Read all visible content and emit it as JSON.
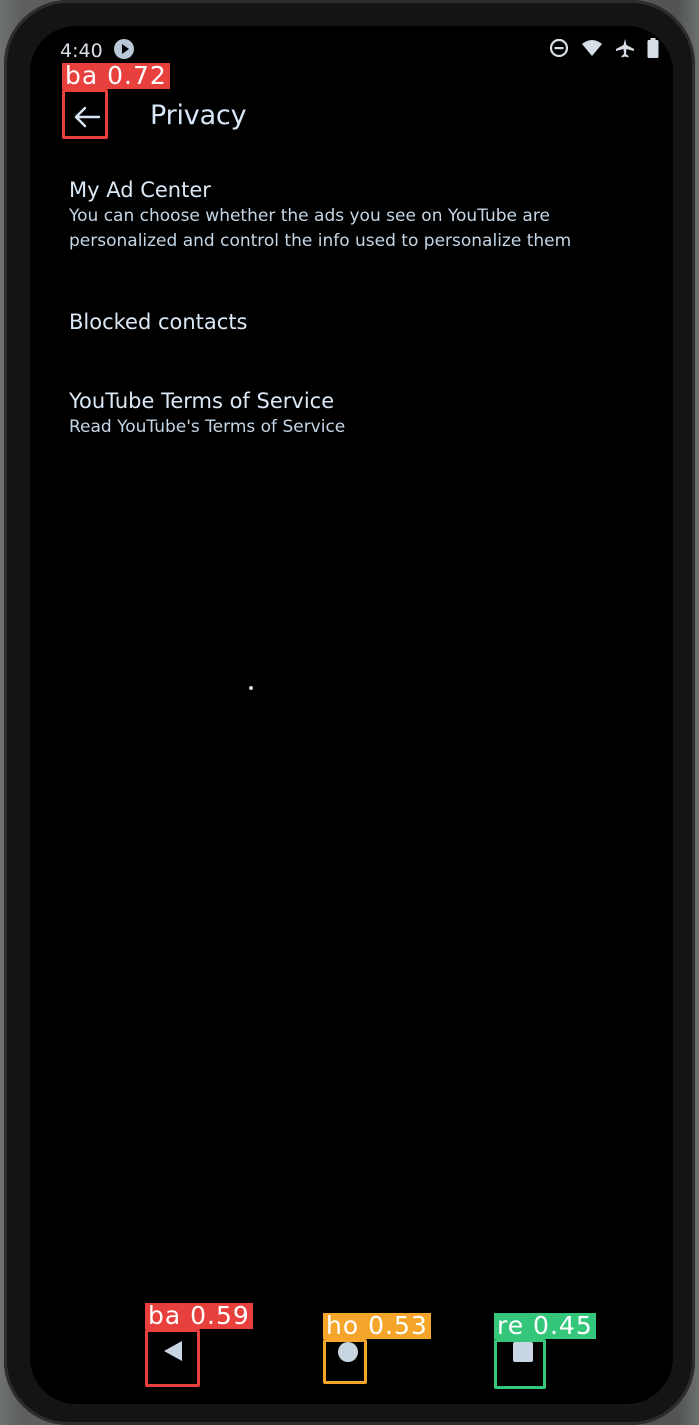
{
  "status_bar": {
    "time": "4:40",
    "app_icon": "youtube-notification-icon",
    "right_icons": [
      "do-not-disturb-icon",
      "wifi-icon",
      "airplane-mode-icon",
      "battery-icon"
    ]
  },
  "app_bar": {
    "back_icon": "arrow-left-icon",
    "title": "Privacy"
  },
  "settings": [
    {
      "title": "My Ad Center",
      "description_line1": "You can choose whether the ads you see on YouTube are",
      "description_line2": "personalized and control the info used to personalize them"
    },
    {
      "title": "Blocked contacts"
    },
    {
      "title": "YouTube Terms of Service",
      "description_line1": "Read YouTube's Terms of Service"
    }
  ],
  "navigation_bar": {
    "back_icon": "triangle-back-icon",
    "home_icon": "circle-home-icon",
    "recents_icon": "square-recents-icon"
  },
  "detections": [
    {
      "label": "ba 0.72",
      "color": "#e8413d"
    },
    {
      "label": "ba 0.59",
      "color": "#e8413d"
    },
    {
      "label": "ho 0.53",
      "color": "#f4a52a"
    },
    {
      "label": "re 0.45",
      "color": "#34c77b"
    }
  ],
  "colors": {
    "background": "#000000",
    "text_primary": "#dbe9f6",
    "text_secondary": "#c4d6e6"
  }
}
